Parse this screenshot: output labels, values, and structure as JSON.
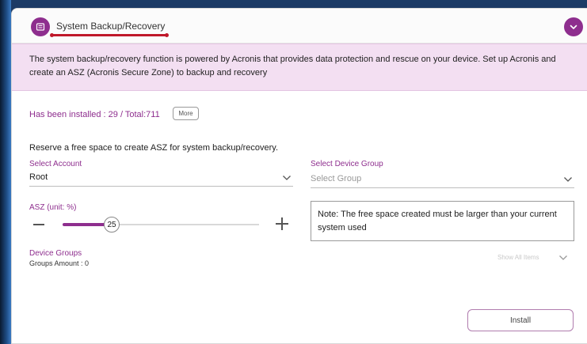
{
  "header": {
    "title": "System Backup/Recovery",
    "icon": "backup-module-icon",
    "collapse_icon": "chevron-down-icon"
  },
  "banner": {
    "text": "The system backup/recovery function is powered by Acronis that provides data protection and rescue on your device. Set up Acronis and create an ASZ (Acronis Secure Zone) to backup and recovery"
  },
  "install_status": {
    "text": "Has been installed : 29 / Total:711",
    "more_label": "More"
  },
  "form": {
    "reserve_text": "Reserve a free space to create ASZ for system backup/recovery.",
    "account": {
      "label": "Select Account",
      "value": "Root"
    },
    "device_group": {
      "label": "Select Device Group",
      "placeholder": "Select Group"
    },
    "asz": {
      "label": "ASZ (unit: %)",
      "value": "25",
      "value_percent": 25
    },
    "note": "Note: The free space created must be larger than your current system used"
  },
  "device_groups": {
    "label": "Device Groups",
    "amount_text": "Groups Amount : 0",
    "show_all_label": "Show All Items"
  },
  "actions": {
    "install_label": "Install"
  },
  "colors": {
    "accent": "#8e2e8e",
    "banner_bg": "#f3dff2",
    "underline": "#c0182a"
  }
}
